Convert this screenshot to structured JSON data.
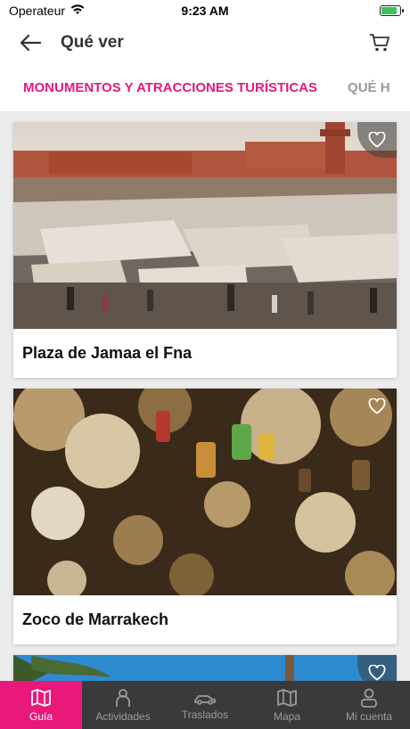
{
  "status": {
    "carrier": "Operateur",
    "time": "9:23 AM",
    "battery_level": 0.85
  },
  "header": {
    "title": "Qué ver"
  },
  "tabs": [
    {
      "label": "MONUMENTOS Y ATRACCIONES TURÍSTICAS"
    },
    {
      "label": "QUÉ H"
    }
  ],
  "cards": [
    {
      "title": "Plaza de Jamaa el Fna",
      "image": "market-square-photo"
    },
    {
      "title": "Zoco de Marrakech",
      "image": "lanterns-souk-photo"
    },
    {
      "title": "",
      "image": "palm-sky-photo"
    }
  ],
  "tabbar": [
    {
      "label": "Guía",
      "icon": "map-book-icon"
    },
    {
      "label": "Actividades",
      "icon": "person-icon"
    },
    {
      "label": "Traslados",
      "icon": "car-icon"
    },
    {
      "label": "Mapa",
      "icon": "map-icon"
    },
    {
      "label": "Mi cuenta",
      "icon": "account-icon"
    }
  ],
  "colors": {
    "accent": "#e8197a",
    "tabbar_bg": "#3a3a3a"
  }
}
